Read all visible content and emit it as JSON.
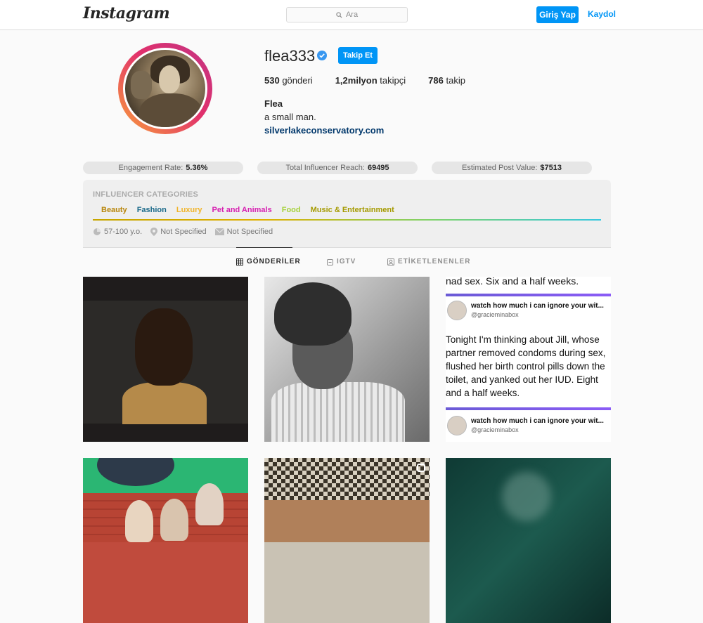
{
  "header": {
    "logo": "Instagram",
    "search_placeholder": "Ara",
    "login_label": "Giriş Yap",
    "signup_label": "Kaydol"
  },
  "profile": {
    "username": "flea333",
    "verified": true,
    "follow_label": "Takip Et",
    "stats": [
      {
        "value": "530",
        "label": "gönderi"
      },
      {
        "value": "1,2milyon",
        "label": "takipçi"
      },
      {
        "value": "786",
        "label": "takip"
      }
    ],
    "full_name": "Flea",
    "bio": "a small man.",
    "website": "silverlakeconservatory.com"
  },
  "metrics": [
    {
      "label": "Engagement Rate:",
      "value": "5.36%"
    },
    {
      "label": "Total Influencer Reach:",
      "value": "69495"
    },
    {
      "label": "Estimated Post Value:",
      "value": "$7513"
    }
  ],
  "categories": {
    "title": "INFLUENCER CATEGORIES",
    "items": [
      {
        "label": "Beauty",
        "color": "#b8860b"
      },
      {
        "label": "Fashion",
        "color": "#1b6a8a"
      },
      {
        "label": "Luxury",
        "color": "#f0b429"
      },
      {
        "label": "Pet and Animals",
        "color": "#d61fb0"
      },
      {
        "label": "Food",
        "color": "#a6d13a"
      },
      {
        "label": "Music & Entertainment",
        "color": "#a59a00"
      }
    ],
    "meta": {
      "age": "57-100 y.o.",
      "location": "Not Specified",
      "email": "Not Specified"
    }
  },
  "tabs": [
    {
      "label": "GÖNDERİLER",
      "active": true,
      "icon": "grid-icon"
    },
    {
      "label": "IGTV",
      "active": false,
      "icon": "igtv-icon"
    },
    {
      "label": "ETİKETLENENLER",
      "active": false,
      "icon": "tagged-icon"
    }
  ],
  "posts": {
    "tweet": {
      "top_text": "nad sex. Six and a half weeks.",
      "card_name": "watch how much i can ignore your wit...",
      "card_handle": "@gracieminabox",
      "body_lines": [
        "Tonight I'm thinking about Jill, whose",
        "partner removed condoms during sex,",
        "flushed her birth control pills down the",
        "toilet, and yanked out her IUD. Eight",
        "and a half weeks."
      ]
    }
  }
}
